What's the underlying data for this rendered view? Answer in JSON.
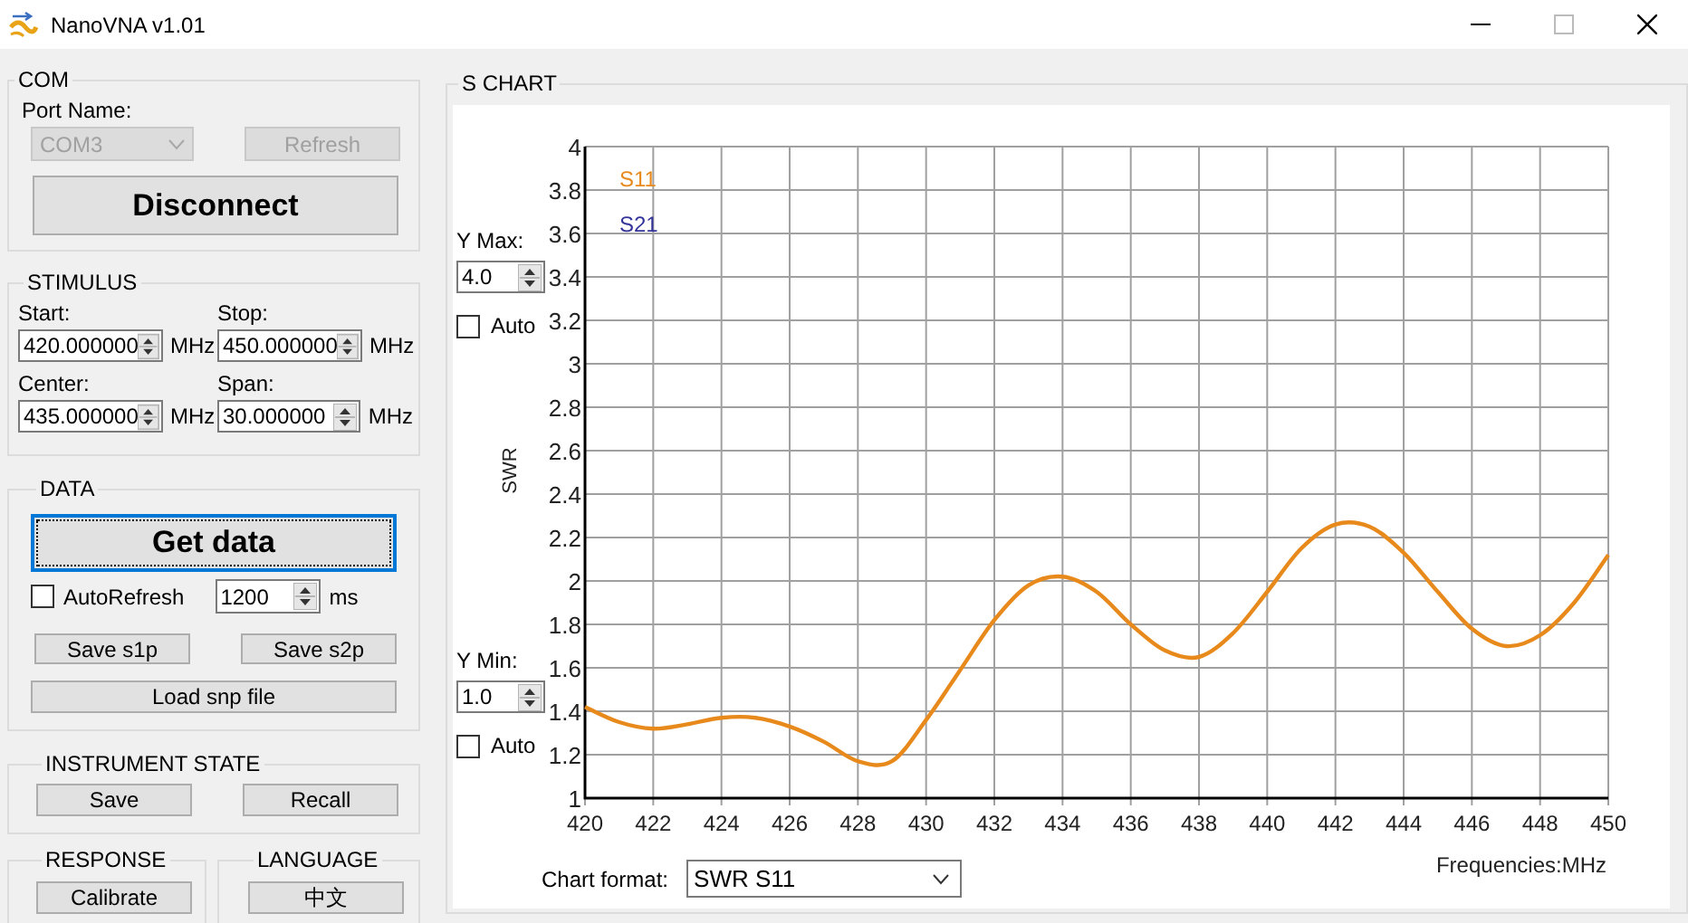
{
  "window": {
    "title": "NanoVNA v1.01"
  },
  "com": {
    "title": "COM",
    "port_label": "Port Name:",
    "port": {
      "value": "COM3",
      "disabled": true
    },
    "refresh": {
      "label": "Refresh",
      "disabled": true
    },
    "connect_button": "Disconnect"
  },
  "stimulus": {
    "title": "STIMULUS",
    "fields": [
      {
        "label": "Start:",
        "value": "420.000000",
        "unit": "MHz"
      },
      {
        "label": "Stop:",
        "value": "450.000000",
        "unit": "MHz"
      },
      {
        "label": "Center:",
        "value": "435.000000",
        "unit": "MHz"
      },
      {
        "label": "Span:",
        "value": "30.000000",
        "unit": "MHz"
      }
    ]
  },
  "data": {
    "title": "DATA",
    "get_button": {
      "label": "Get data",
      "focused": true
    },
    "auto_refresh": {
      "label": "AutoRefresh",
      "checked": false
    },
    "interval": {
      "value": "1200",
      "unit": "ms"
    },
    "save_buttons": [
      "Save s1p",
      "Save s2p"
    ],
    "load_button": "Load snp file"
  },
  "instrument_state": {
    "title": "INSTRUMENT STATE",
    "buttons": [
      "Save",
      "Recall"
    ]
  },
  "response": {
    "title": "RESPONSE",
    "button": "Calibrate"
  },
  "language": {
    "title": "LANGUAGE",
    "button": "中文"
  },
  "s_chart": {
    "title": "S CHART",
    "y_max": {
      "label": "Y Max:",
      "value": "4.0",
      "auto": {
        "label": "Auto",
        "checked": false
      }
    },
    "y_min": {
      "label": "Y Min:",
      "value": "1.0",
      "auto": {
        "label": "Auto",
        "checked": false
      }
    },
    "chart_format": {
      "label": "Chart format:",
      "value": "SWR S11"
    },
    "chart_data": {
      "type": "line",
      "xlabel": "Frequencies:MHz",
      "ylabel": "SWR",
      "x": [
        420,
        421,
        422,
        423,
        424,
        425,
        426,
        427,
        428,
        429,
        430,
        431,
        432,
        433,
        434,
        435,
        436,
        437,
        438,
        439,
        440,
        441,
        442,
        443,
        444,
        445,
        446,
        447,
        448,
        449,
        450
      ],
      "series": [
        {
          "name": "S11",
          "color": "#e8891c",
          "values": [
            1.42,
            1.35,
            1.32,
            1.34,
            1.37,
            1.37,
            1.33,
            1.26,
            1.17,
            1.17,
            1.36,
            1.59,
            1.82,
            1.98,
            2.02,
            1.95,
            1.8,
            1.68,
            1.65,
            1.76,
            1.95,
            2.15,
            2.26,
            2.25,
            2.13,
            1.95,
            1.78,
            1.7,
            1.75,
            1.9,
            2.12
          ]
        },
        {
          "name": "S21",
          "color": "#333399",
          "values": [
            null,
            null,
            null,
            null,
            null,
            null,
            null,
            null,
            null,
            null,
            null,
            null,
            null,
            null,
            null,
            null,
            null,
            null,
            null,
            null,
            null,
            null,
            null,
            null,
            null,
            null,
            null,
            null,
            null,
            null,
            null
          ]
        }
      ],
      "xlim": [
        420,
        450
      ],
      "ylim": [
        1,
        4
      ],
      "grid": true,
      "xticks": [
        420,
        422,
        424,
        426,
        428,
        430,
        432,
        434,
        436,
        438,
        440,
        442,
        444,
        446,
        448,
        450
      ],
      "yticks": [
        1,
        1.2,
        1.4,
        1.6,
        1.8,
        2,
        2.2,
        2.4,
        2.6,
        2.8,
        3,
        3.2,
        3.4,
        3.6,
        3.8,
        4
      ]
    }
  }
}
